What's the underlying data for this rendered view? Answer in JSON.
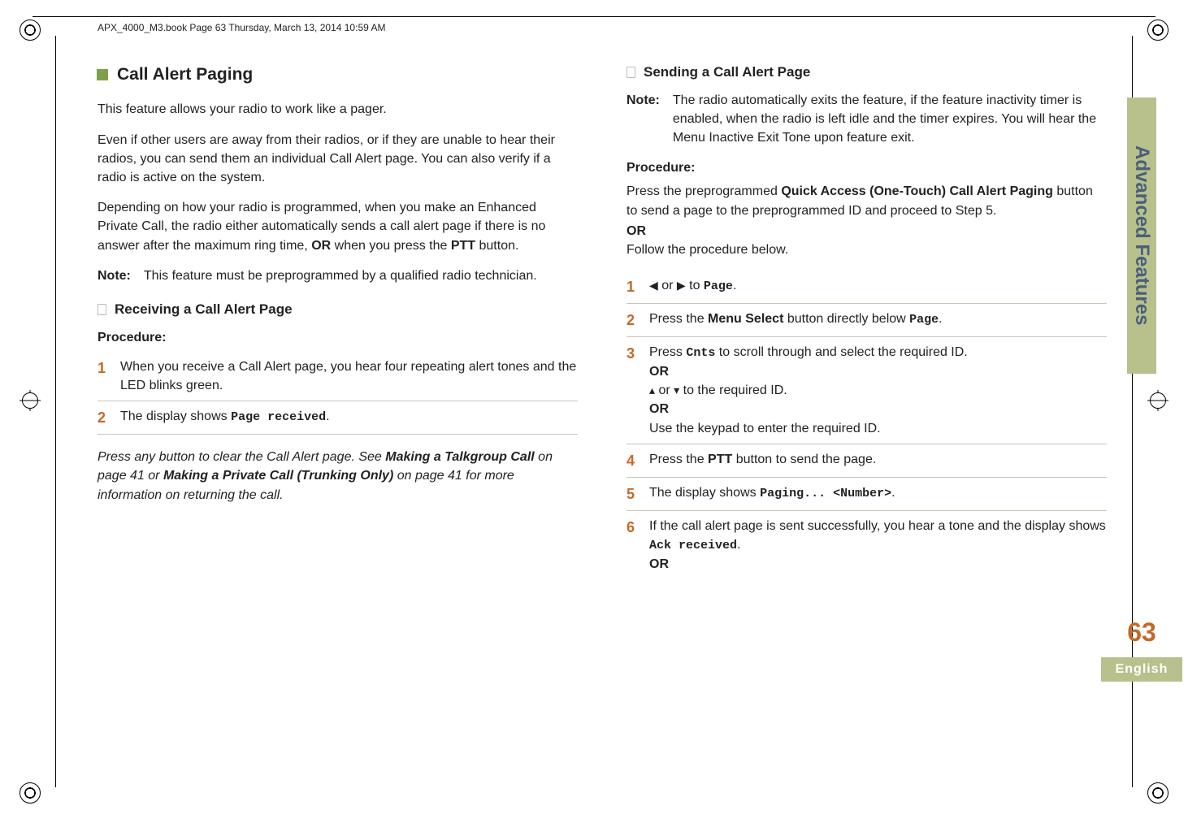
{
  "header": "APX_4000_M3.book  Page 63  Thursday, March 13, 2014  10:59 AM",
  "sidebar": {
    "tab": "Advanced Features",
    "page_number": "63",
    "language": "English"
  },
  "left": {
    "section_title": "Call Alert Paging",
    "p1": "This feature allows your radio to work like a pager.",
    "p2": "Even if other users are away from their radios, or if they are unable to hear their radios, you can send them an individual Call Alert page. You can also verify if a radio is active on the system.",
    "p3a": "Depending on how your radio is programmed, when you make an Enhanced Private Call, the radio either automatically sends a call alert page if there is no answer after the maximum ring time, ",
    "p3_or": "OR",
    "p3b": " when you press the ",
    "p3_ptt": "PTT",
    "p3c": " button.",
    "note_label": "Note:",
    "note_text": "This feature must be preprogrammed by a qualified radio technician.",
    "sub_title": "Receiving a Call Alert Page",
    "procedure_label": "Procedure:",
    "step1": "When you receive a Call Alert page, you hear four repeating alert tones and the LED blinks green.",
    "step2a": "The display shows ",
    "step2_term": "Page received",
    "step2b": ".",
    "tail_a": "Press any button to clear the Call Alert page. See ",
    "tail_b": "Making a Talkgroup Call",
    "tail_c": " on page 41 or ",
    "tail_d": "Making a Private Call (Trunking Only)",
    "tail_e": " on page 41 for more information on returning the call."
  },
  "right": {
    "sub_title": "Sending a Call Alert Page",
    "note_label": "Note:",
    "note_text": "The radio automatically exits the feature, if the feature inactivity timer is enabled, when the radio is left idle and the timer expires. You will hear the Menu Inactive Exit Tone upon feature exit.",
    "procedure_label": "Procedure:",
    "proc_p1a": "Press the preprogrammed ",
    "proc_p1b": "Quick Access (One-Touch) Call Alert Paging",
    "proc_p1c": " button to send a page to the preprogrammed ID and proceed to Step 5.",
    "or": "OR",
    "proc_p2": "Follow the procedure below.",
    "s1_a": " or ",
    "s1_b": " to ",
    "s1_term": "Page",
    "s1_c": ".",
    "s2_a": "Press the ",
    "s2_b": "Menu Select",
    "s2_c": " button directly below ",
    "s2_term": "Page",
    "s2_d": ".",
    "s3_a": "Press ",
    "s3_term1": "Cnts",
    "s3_b": " to scroll through and select the required ID.",
    "s3_or": "OR",
    "s3_c": " or ",
    "s3_d": " to the required ID.",
    "s3_or2": "OR",
    "s3_e": "Use the keypad to enter the required ID.",
    "s4_a": "Press the ",
    "s4_b": "PTT",
    "s4_c": " button to send the page.",
    "s5_a": "The display shows ",
    "s5_term": "Paging... <Number>",
    "s5_b": ".",
    "s6_a": "If the call alert page is sent successfully, you hear a tone and the display shows ",
    "s6_term": "Ack received",
    "s6_b": ".",
    "s6_or": "OR"
  },
  "step_numbers": {
    "n1": "1",
    "n2": "2",
    "n3": "3",
    "n4": "4",
    "n5": "5",
    "n6": "6"
  },
  "arrows": {
    "left": "◀",
    "right": "▶",
    "up": "▴",
    "down": "▾"
  }
}
